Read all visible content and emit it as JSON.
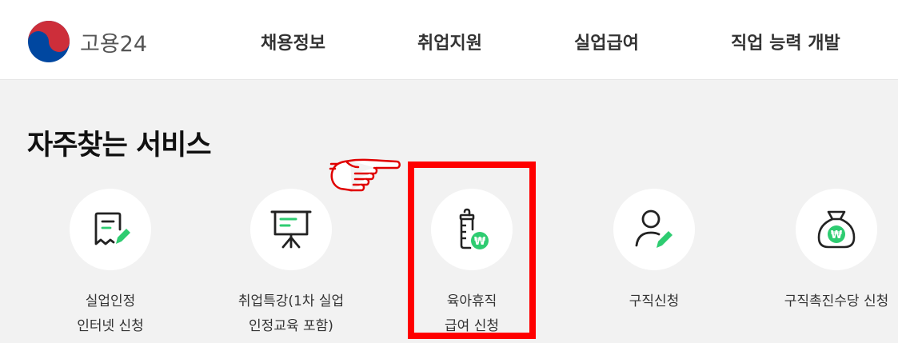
{
  "logo": {
    "text": "고용24",
    "icon": "taegeuk-icon"
  },
  "nav": [
    {
      "label": "채용정보"
    },
    {
      "label": "취업지원"
    },
    {
      "label": "실업급여"
    },
    {
      "label": "직업 능력 개발"
    }
  ],
  "section_title": "자주찾는 서비스",
  "services": [
    {
      "icon": "receipt-pencil-icon",
      "line1": "실업인정",
      "line2": "인터넷 신청"
    },
    {
      "icon": "presentation-board-icon",
      "line1": "취업특강(1차 실업",
      "line2": "인정교육 포함)"
    },
    {
      "icon": "baby-bottle-won-icon",
      "line1": "육아휴직",
      "line2": "급여 신청",
      "badge": "₩"
    },
    {
      "icon": "person-pencil-icon",
      "line1": "구직신청",
      "line2": ""
    },
    {
      "icon": "money-bag-won-icon",
      "line1": "구직촉진수당 신청",
      "line2": "",
      "badge": "₩"
    }
  ],
  "colors": {
    "accent_green": "#2ecc71",
    "highlight_red": "#ff0000",
    "logo_red": "#cd2e3a",
    "logo_blue": "#0047a0"
  }
}
